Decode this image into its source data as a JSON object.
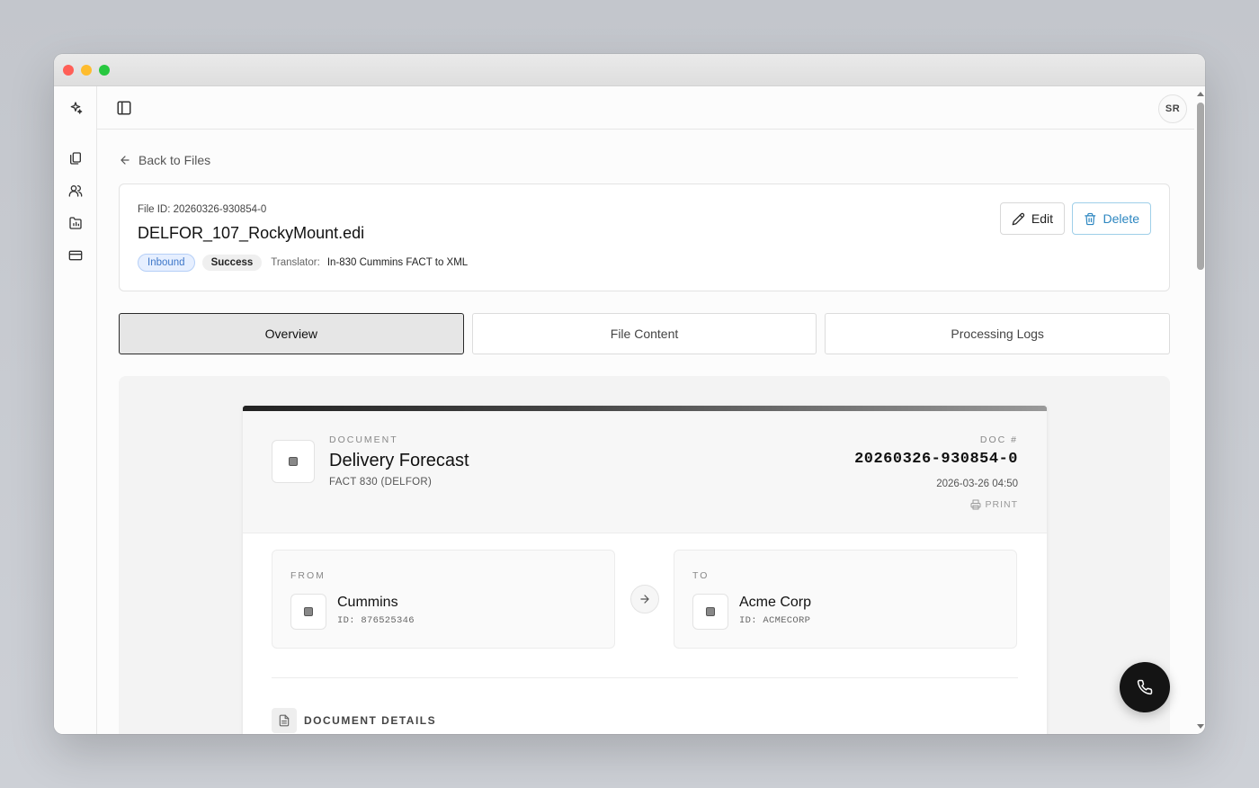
{
  "user": {
    "initials": "SR"
  },
  "nav": {
    "back_label": "Back to Files"
  },
  "file": {
    "id_text": "File ID: 20260326-930854-0",
    "name": "DELFOR_107_RockyMount.edi",
    "direction": "Inbound",
    "status": "Success",
    "translator_label": "Translator:",
    "translator": "In-830 Cummins FACT to XML"
  },
  "actions": {
    "edit_label": "Edit",
    "delete_label": "Delete"
  },
  "tabs": [
    {
      "label": "Overview",
      "active": true
    },
    {
      "label": "File Content",
      "active": false
    },
    {
      "label": "Processing Logs",
      "active": false
    }
  ],
  "document": {
    "kicker": "DOCUMENT",
    "title": "Delivery Forecast",
    "subtitle": "FACT 830 (DELFOR)",
    "doc_no_label": "DOC #",
    "doc_no": "20260326-930854-0",
    "date": "2026-03-26 04:50",
    "print_label": "PRINT"
  },
  "from": {
    "label": "FROM",
    "name": "Cummins",
    "id": "ID: 876525346"
  },
  "to": {
    "label": "TO",
    "name": "Acme Corp",
    "id": "ID: ACMECORP"
  },
  "details": {
    "label": "DOCUMENT DETAILS"
  },
  "colors": {
    "accent_blue": "#2c86c0",
    "badge_blue_bg": "#e6efff",
    "dark": "#141414"
  },
  "icons": {
    "rail": [
      "sparkle-icon",
      "files-icon",
      "users-icon",
      "folder-chart-icon",
      "credit-card-icon"
    ],
    "fab": "phone-icon"
  }
}
